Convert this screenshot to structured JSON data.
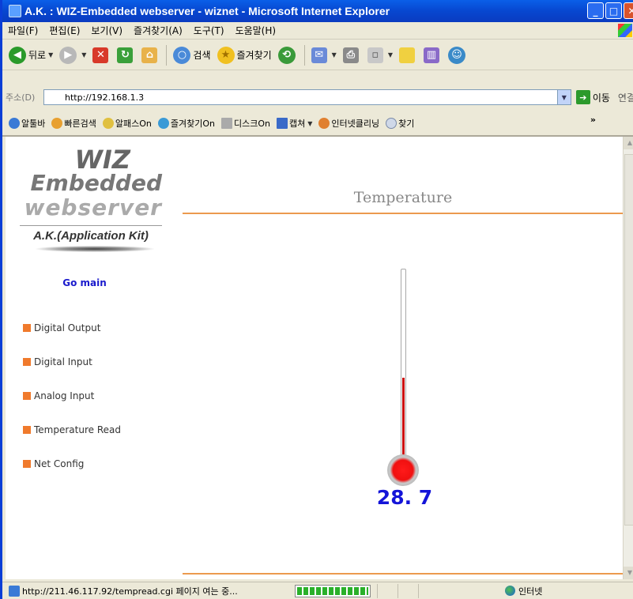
{
  "window": {
    "title": "A.K. : WIZ-Embedded webserver - wiznet - Microsoft Internet Explorer"
  },
  "menu": [
    "파일(F)",
    "편집(E)",
    "보기(V)",
    "즐겨찾기(A)",
    "도구(T)",
    "도움말(H)"
  ],
  "toolbar": {
    "back": "뒤로",
    "search": "검색",
    "favorites": "즐겨찾기"
  },
  "address": {
    "label": "주소(D)",
    "url": "http://192.168.1.3",
    "go": "이동",
    "links": "연결"
  },
  "links_bar": [
    "알툴바",
    "빠른검색",
    "알패스On",
    "즐겨찾기On",
    "디스크On",
    "캡쳐",
    "인터넷클리닝",
    "찾기"
  ],
  "logo": {
    "line1": "WIZ",
    "line2": "Embedded",
    "line3": "webserver",
    "kit": "A.K.(Application Kit)"
  },
  "sidebar": {
    "go_main": "Go main",
    "items": [
      "Digital Output",
      "Digital Input",
      "Analog Input",
      "Temperature Read",
      "Net Config"
    ]
  },
  "main": {
    "heading": "Temperature",
    "reading": "28. 7",
    "level": 0.48
  },
  "status": {
    "text": "http://211.46.117.92/tempread.cgi 페이지 여는 중...",
    "progress": 1.0,
    "zone": "인터넷"
  },
  "colors": {
    "accent": "#ec9a4e",
    "nav_bullet": "#f07a2c",
    "reading": "#1414d8",
    "mercury": "#cc1010"
  }
}
